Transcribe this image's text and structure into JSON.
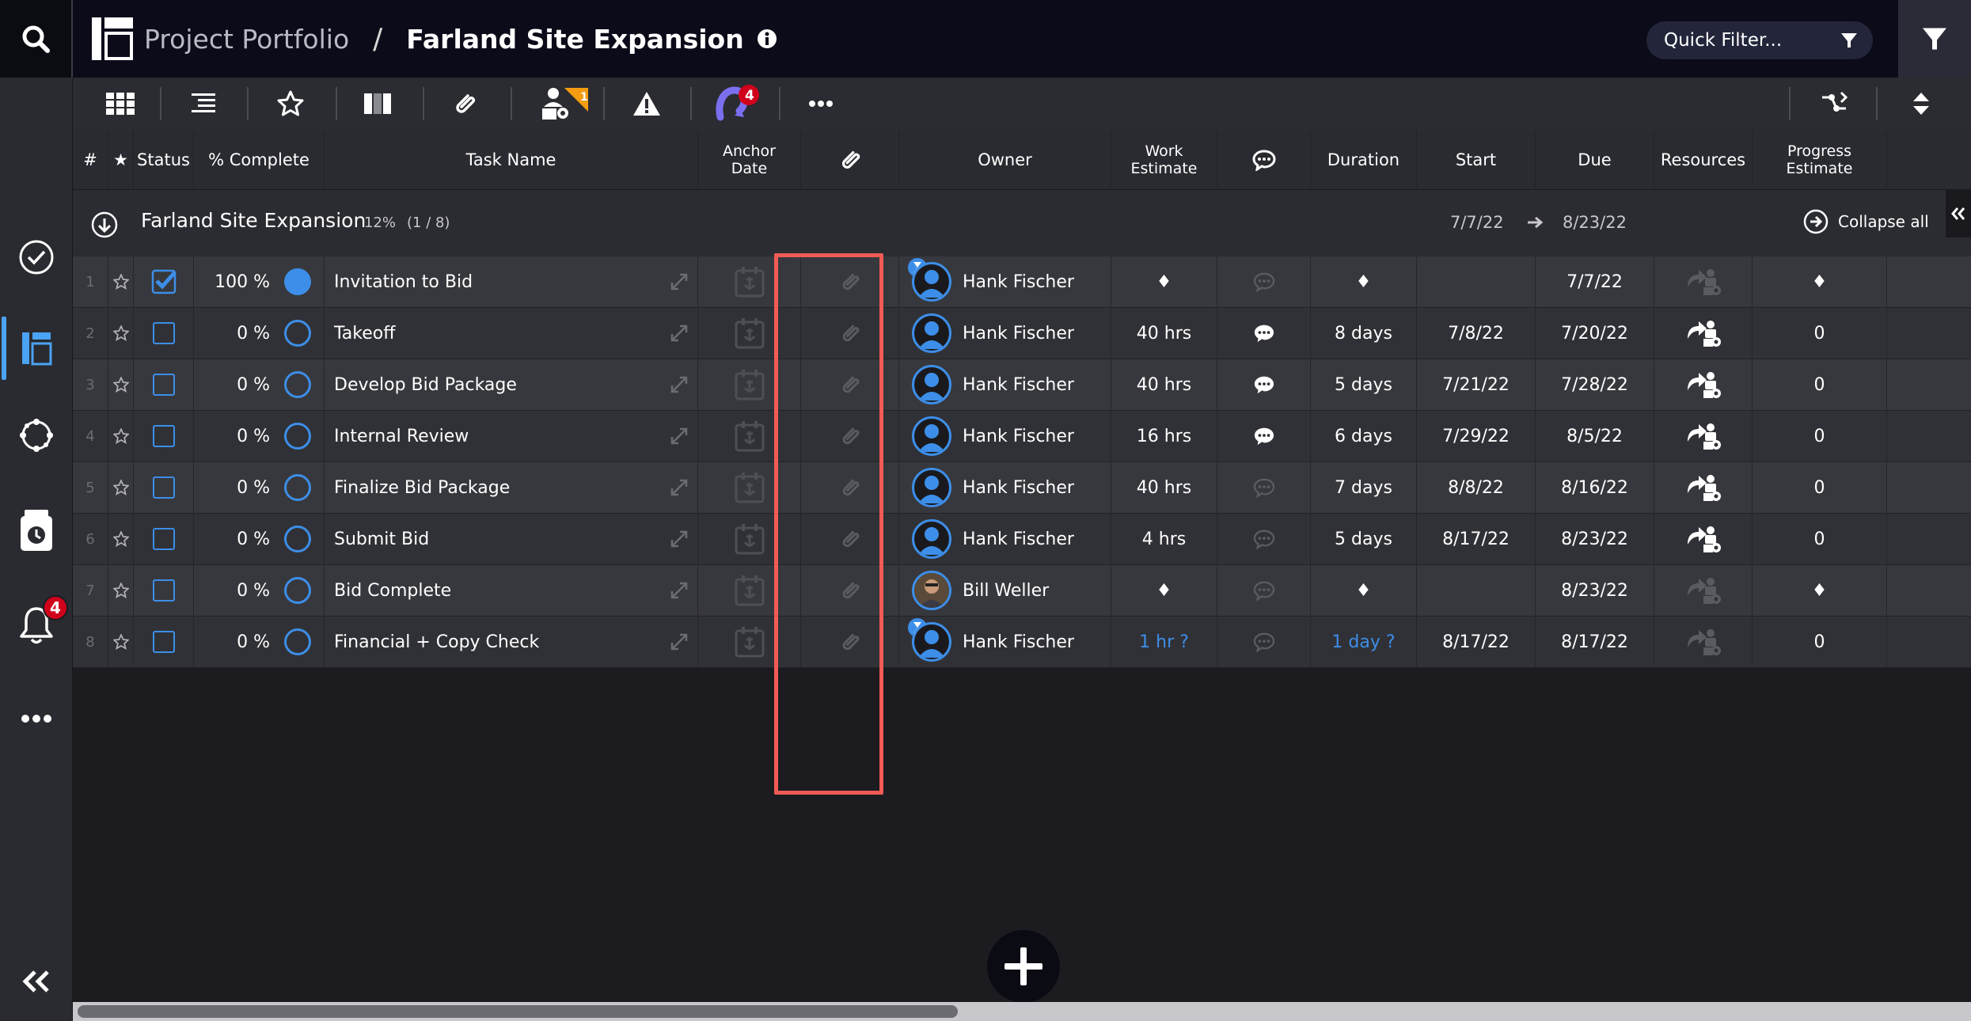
{
  "header": {
    "portfolio": "Project Portfolio",
    "separator": "/",
    "project": "Farland Site Expansion",
    "quick_filter_placeholder": "Quick Filter..."
  },
  "toolbar": {
    "resource_badge": "1",
    "notify_badge": "4"
  },
  "sidebar": {
    "alerts_badge": "4"
  },
  "columns": {
    "num": "#",
    "star": "★",
    "status": "Status",
    "pct": "% Complete",
    "task": "Task Name",
    "anchor_1": "Anchor",
    "anchor_2": "Date",
    "owner": "Owner",
    "work_1": "Work",
    "work_2": "Estimate",
    "duration": "Duration",
    "start": "Start",
    "due": "Due",
    "resources": "Resources",
    "progress_1": "Progress",
    "progress_2": "Estimate"
  },
  "group": {
    "name": "Farland Site Expansion",
    "pct": "12%",
    "count": "(1 / 8)",
    "start": "7/7/22",
    "due": "8/23/22",
    "collapse": "Collapse all"
  },
  "rows": [
    {
      "num": "1",
      "done": true,
      "pct": "100 %",
      "task": "Invitation to Bid",
      "owner": "Hank Fischer",
      "work": "♦",
      "comment": false,
      "duration": "♦",
      "start": "",
      "due": "7/7/22",
      "res": false,
      "progress": "♦",
      "hourglass": true,
      "photo": false,
      "est": false
    },
    {
      "num": "2",
      "done": false,
      "pct": "0 %",
      "task": "Takeoff",
      "owner": "Hank Fischer",
      "work": "40 hrs",
      "comment": true,
      "duration": "8 days",
      "start": "7/8/22",
      "due": "7/20/22",
      "res": true,
      "progress": "0",
      "hourglass": false,
      "photo": false,
      "est": false
    },
    {
      "num": "3",
      "done": false,
      "pct": "0 %",
      "task": "Develop Bid Package",
      "owner": "Hank Fischer",
      "work": "40 hrs",
      "comment": true,
      "duration": "5 days",
      "start": "7/21/22",
      "due": "7/28/22",
      "res": true,
      "progress": "0",
      "hourglass": false,
      "photo": false,
      "est": false
    },
    {
      "num": "4",
      "done": false,
      "pct": "0 %",
      "task": "Internal Review",
      "owner": "Hank Fischer",
      "work": "16 hrs",
      "comment": true,
      "duration": "6 days",
      "start": "7/29/22",
      "due": "8/5/22",
      "res": true,
      "progress": "0",
      "hourglass": false,
      "photo": false,
      "est": false
    },
    {
      "num": "5",
      "done": false,
      "pct": "0 %",
      "task": "Finalize Bid Package",
      "owner": "Hank Fischer",
      "work": "40 hrs",
      "comment": false,
      "duration": "7 days",
      "start": "8/8/22",
      "due": "8/16/22",
      "res": true,
      "progress": "0",
      "hourglass": false,
      "photo": false,
      "est": false
    },
    {
      "num": "6",
      "done": false,
      "pct": "0 %",
      "task": "Submit Bid",
      "owner": "Hank Fischer",
      "work": "4 hrs",
      "comment": false,
      "duration": "5 days",
      "start": "8/17/22",
      "due": "8/23/22",
      "res": true,
      "progress": "0",
      "hourglass": false,
      "photo": false,
      "est": false
    },
    {
      "num": "7",
      "done": false,
      "pct": "0 %",
      "task": "Bid Complete",
      "owner": "Bill Weller",
      "work": "♦",
      "comment": false,
      "duration": "♦",
      "start": "",
      "due": "8/23/22",
      "res": false,
      "progress": "♦",
      "hourglass": false,
      "photo": true,
      "est": false
    },
    {
      "num": "8",
      "done": false,
      "pct": "0 %",
      "task": "Financial + Copy Check",
      "owner": "Hank Fischer",
      "work": "1 hr ?",
      "comment": false,
      "duration": "1 day ?",
      "start": "8/17/22",
      "due": "8/17/22",
      "res": false,
      "progress": "0",
      "hourglass": true,
      "photo": false,
      "est": true
    }
  ],
  "colors": {
    "accent": "#3d8ee8",
    "highlight": "#f25b55",
    "badge": "#d0021b",
    "resource_badge": "#f39c12"
  }
}
